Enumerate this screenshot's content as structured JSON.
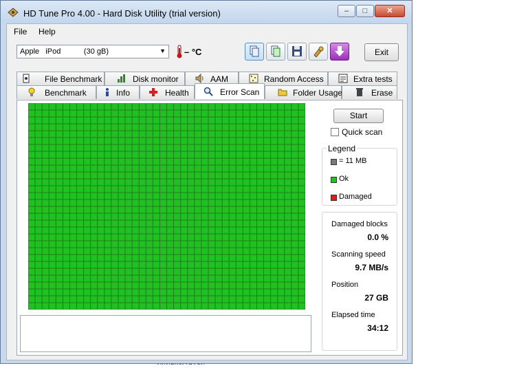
{
  "window": {
    "title": "HD Tune Pro 4.00 - Hard Disk Utility (trial version)"
  },
  "menu": {
    "file": "File",
    "help": "Help"
  },
  "drive": {
    "name": "Apple   iPod           (30 gB)",
    "temperature": "– °C"
  },
  "toolbar": {
    "exit_label": "Exit"
  },
  "tabs_top": [
    "File Benchmark",
    "Disk monitor",
    "AAM",
    "Random Access",
    "Extra tests"
  ],
  "tabs_bottom": [
    "Benchmark",
    "Info",
    "Health",
    "Error Scan",
    "Folder Usage",
    "Erase"
  ],
  "selected_tab": "Error Scan",
  "scan": {
    "start_label": "Start",
    "quick_scan_label": "Quick scan",
    "quick_scan_checked": false,
    "grid_cols": 40,
    "grid_rows": 30,
    "block_color_ok": "#22c122"
  },
  "legend": {
    "title": "Legend",
    "block_size": "= 11 MB",
    "ok": "Ok",
    "damaged": "Damaged",
    "colors": {
      "block": "#7a7a7a",
      "ok": "#22c122",
      "damaged": "#d42020"
    }
  },
  "stats": {
    "damaged_blocks_label": "Damaged blocks",
    "damaged_blocks_value": "0.0 %",
    "scanning_speed_label": "Scanning speed",
    "scanning_speed_value": "9.7 MB/s",
    "position_label": "Position",
    "position_value": "27 GB",
    "elapsed_label": "Elapsed time",
    "elapsed_value": "34:12"
  },
  "background_fragment": "ตดตอฝงเวปไซต"
}
